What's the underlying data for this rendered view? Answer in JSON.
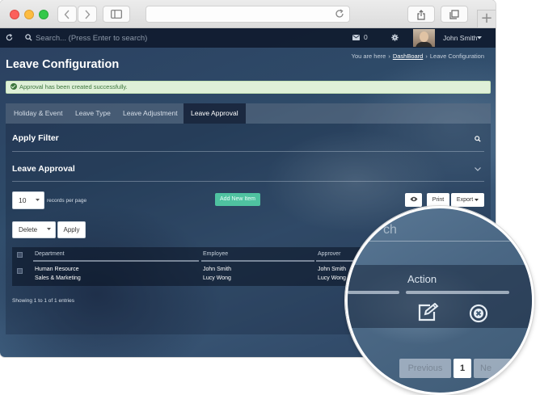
{
  "topbar": {
    "search_placeholder": "Search... (Press Enter to search)",
    "mail_count": "0",
    "user_name": "John Smith"
  },
  "page": {
    "title": "Leave Configuration",
    "breadcrumb": {
      "prefix": "You are here",
      "link": "DashBoard",
      "current": "Leave Configuration"
    }
  },
  "alert": {
    "message": "Approval has been created successfully."
  },
  "tabs": [
    {
      "label": "Holiday & Event"
    },
    {
      "label": "Leave Type"
    },
    {
      "label": "Leave Adjustment"
    },
    {
      "label": "Leave Approval",
      "active": true
    }
  ],
  "sections": {
    "filter_title": "Apply Filter",
    "approval_title": "Leave Approval"
  },
  "controls": {
    "page_size": "10",
    "page_size_label": "records per page",
    "add_new_label": "Add New Item",
    "print_label": "Print",
    "export_label": "Export",
    "bulk_action": "Delete",
    "apply_label": "Apply"
  },
  "table": {
    "columns": [
      "Department",
      "Employee",
      "Approver"
    ],
    "rows": [
      {
        "department": "Human Resource",
        "employee": "John Smith",
        "approver": "John Smith"
      },
      {
        "department": "Sales & Marketing",
        "employee": "Lucy Wong",
        "approver": "Lucy Wong"
      }
    ],
    "summary": "Showing 1 to 1 of 1 entries"
  },
  "magnifier": {
    "search_fragment": "ch",
    "action_header": "Action",
    "pager": {
      "previous": "Previous",
      "page": "1",
      "next": "Ne"
    }
  },
  "colors": {
    "add_button": "#4fc2a0",
    "alert_bg": "#dff0d8",
    "alert_text": "#3c763d",
    "topbar": "#0c1628"
  }
}
